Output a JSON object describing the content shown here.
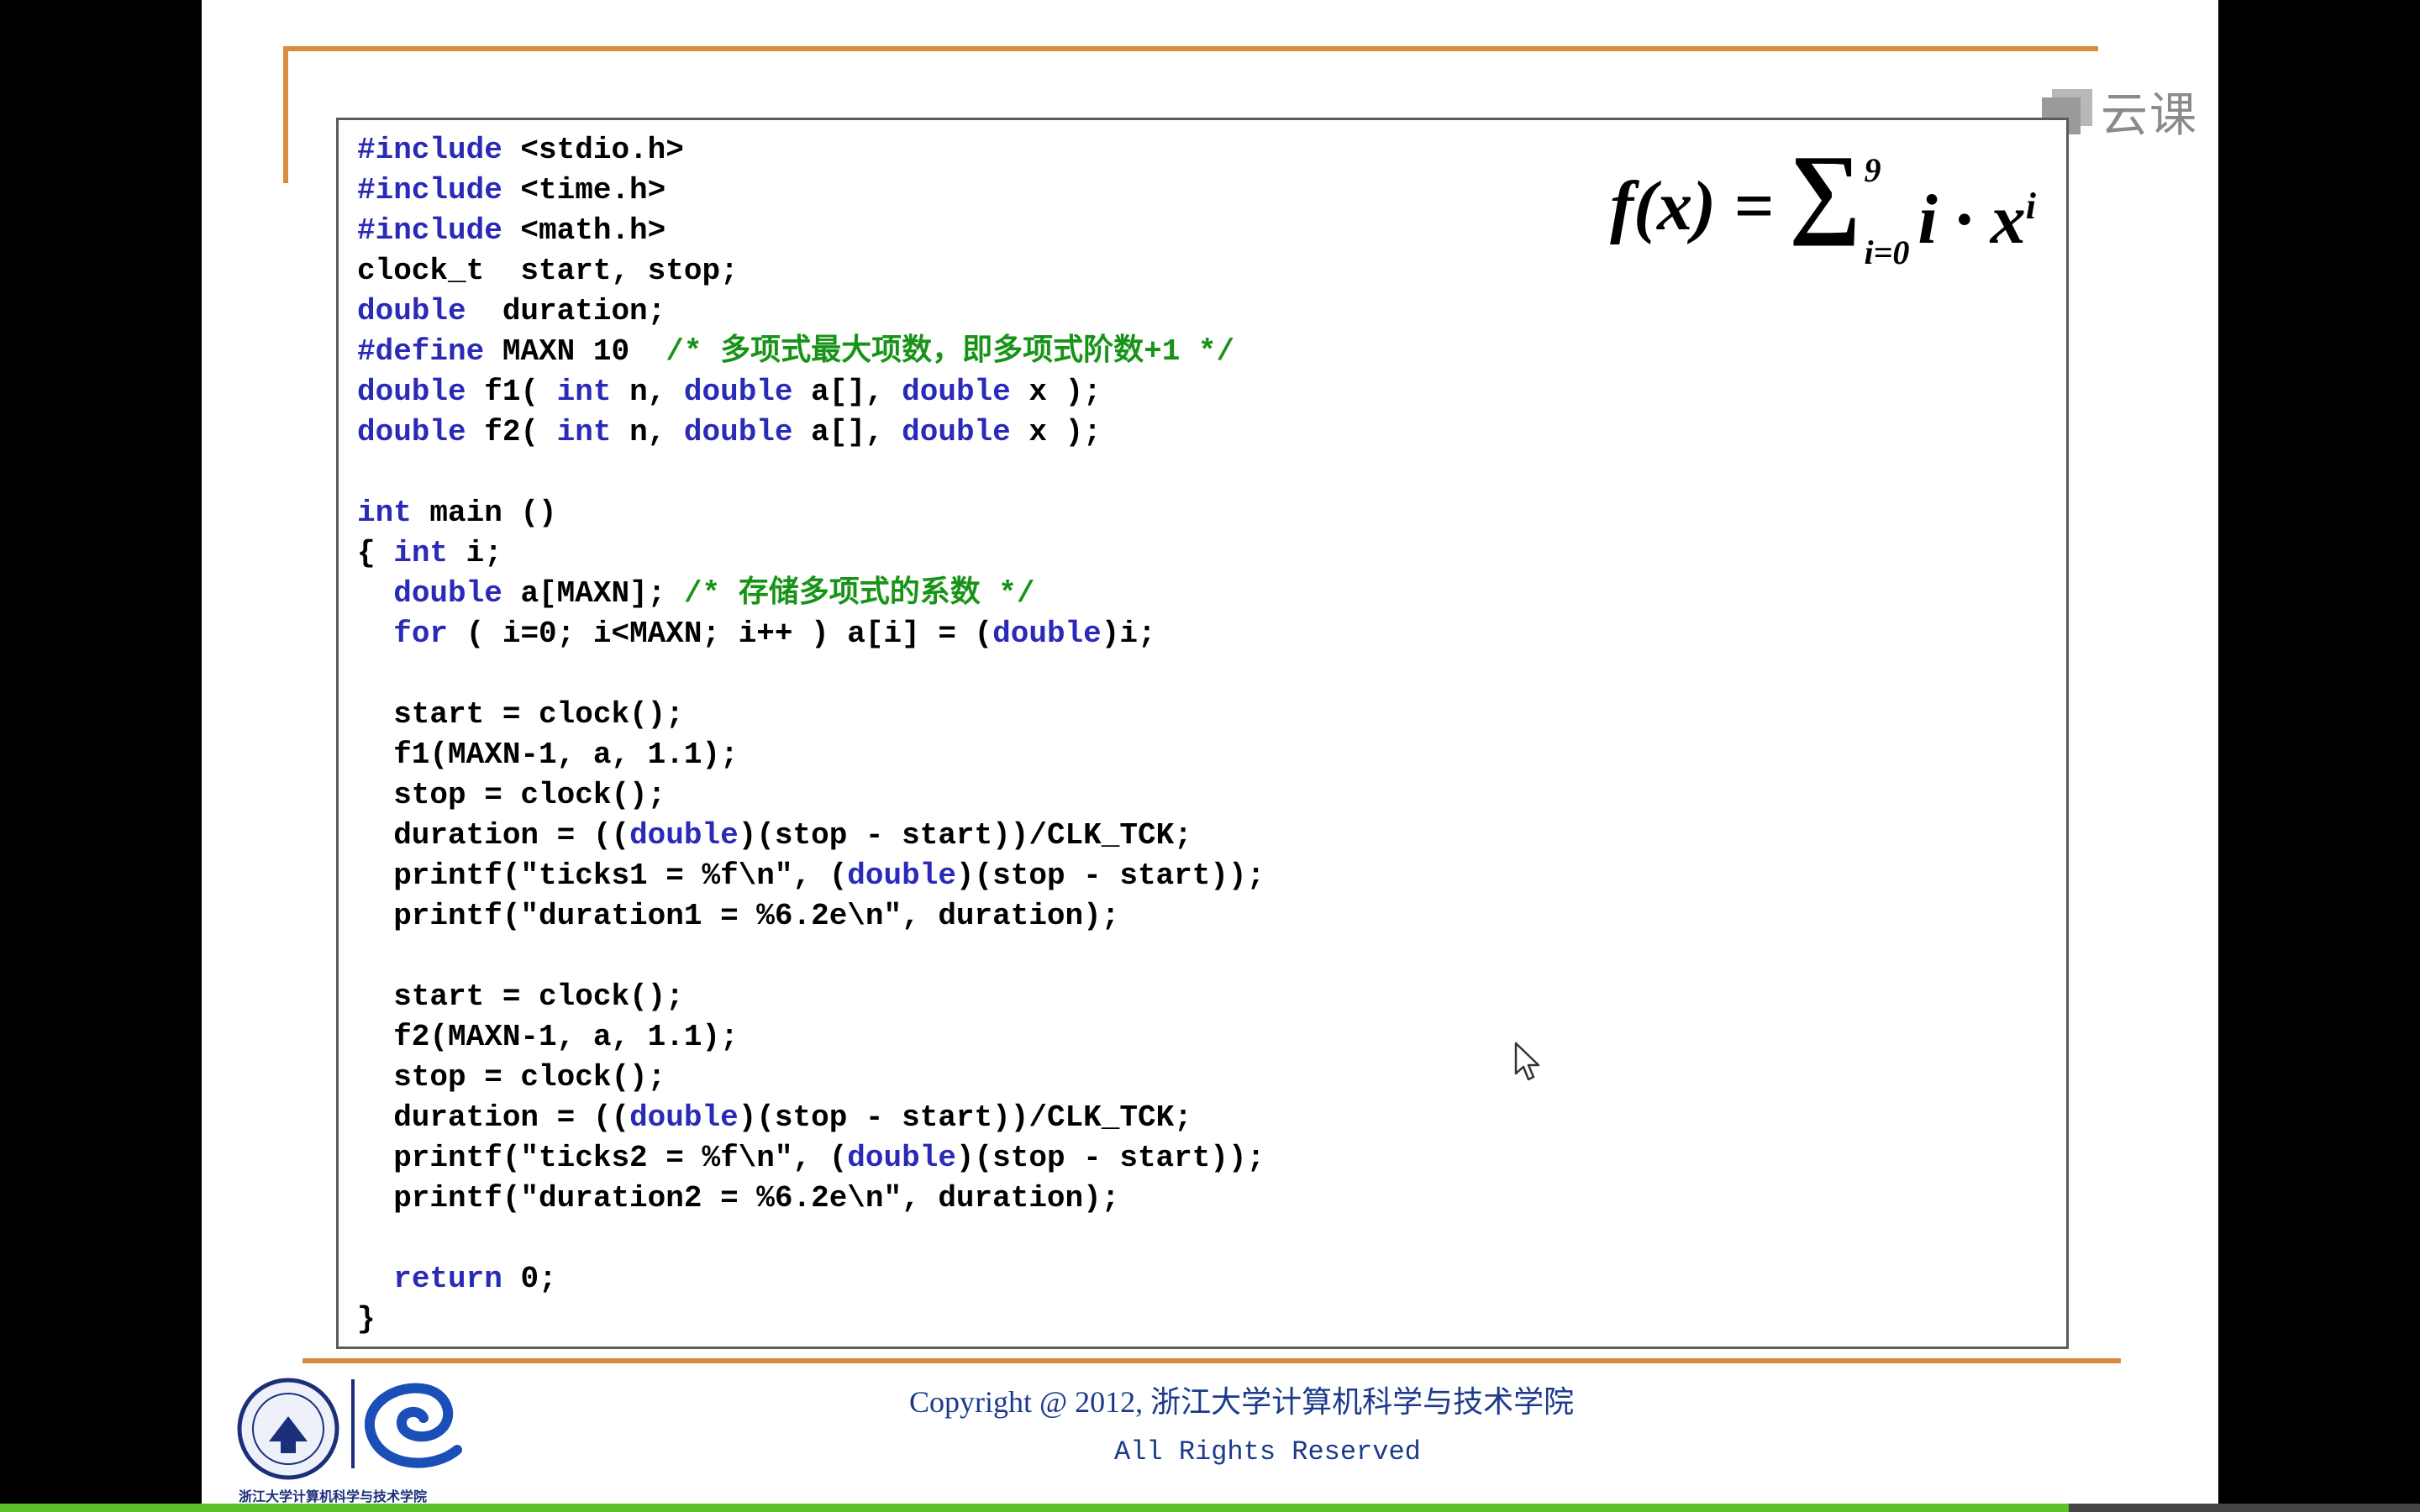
{
  "slide": {
    "formula": {
      "lhs": "f(x)",
      "equals": "=",
      "sum_symbol": "∑",
      "upper_limit": "9",
      "lower_limit": "i=0",
      "term": "i · x",
      "exponent": "i"
    },
    "watermark": {
      "text": "云课",
      "icon": "video-player-icon"
    },
    "code_lines": [
      [
        {
          "k": "kw",
          "t": "#include"
        },
        {
          "t": " <stdio.h>"
        }
      ],
      [
        {
          "k": "kw",
          "t": "#include"
        },
        {
          "t": " <time.h>"
        }
      ],
      [
        {
          "k": "kw",
          "t": "#include"
        },
        {
          "t": " <math.h>"
        }
      ],
      [
        {
          "t": "clock_t  start, stop;"
        }
      ],
      [
        {
          "k": "kw",
          "t": "double"
        },
        {
          "t": "  duration;"
        }
      ],
      [
        {
          "k": "kw",
          "t": "#define"
        },
        {
          "t": " MAXN 10  "
        },
        {
          "k": "cm",
          "t": "/* 多项式最大项数，即多项式阶数+1 */"
        }
      ],
      [
        {
          "k": "kw",
          "t": "double"
        },
        {
          "t": " f1( "
        },
        {
          "k": "kw",
          "t": "int"
        },
        {
          "t": " n, "
        },
        {
          "k": "kw",
          "t": "double"
        },
        {
          "t": " a[], "
        },
        {
          "k": "kw",
          "t": "double"
        },
        {
          "t": " x );"
        }
      ],
      [
        {
          "k": "kw",
          "t": "double"
        },
        {
          "t": " f2( "
        },
        {
          "k": "kw",
          "t": "int"
        },
        {
          "t": " n, "
        },
        {
          "k": "kw",
          "t": "double"
        },
        {
          "t": " a[], "
        },
        {
          "k": "kw",
          "t": "double"
        },
        {
          "t": " x );"
        }
      ],
      [
        {
          "t": ""
        }
      ],
      [
        {
          "k": "kw",
          "t": "int"
        },
        {
          "t": " main ()"
        }
      ],
      [
        {
          "t": "{ "
        },
        {
          "k": "kw",
          "t": "int"
        },
        {
          "t": " i;"
        }
      ],
      [
        {
          "t": "  "
        },
        {
          "k": "kw",
          "t": "double"
        },
        {
          "t": " a[MAXN]; "
        },
        {
          "k": "cm",
          "t": "/* 存储多项式的系数 */"
        }
      ],
      [
        {
          "t": "  "
        },
        {
          "k": "kw",
          "t": "for"
        },
        {
          "t": " ( i=0; i<MAXN; i++ ) a[i] = ("
        },
        {
          "k": "kw",
          "t": "double"
        },
        {
          "t": ")i;"
        }
      ],
      [
        {
          "t": ""
        }
      ],
      [
        {
          "t": "  start = clock();"
        }
      ],
      [
        {
          "t": "  f1(MAXN-1, a, 1.1);"
        }
      ],
      [
        {
          "t": "  stop = clock();"
        }
      ],
      [
        {
          "t": "  duration = (("
        },
        {
          "k": "kw",
          "t": "double"
        },
        {
          "t": ")(stop - start))/CLK_TCK;"
        }
      ],
      [
        {
          "t": "  printf(\"ticks1 = %f\\n\", ("
        },
        {
          "k": "kw",
          "t": "double"
        },
        {
          "t": ")(stop - start));"
        }
      ],
      [
        {
          "t": "  printf(\"duration1 = %6.2e\\n\", duration);"
        }
      ],
      [
        {
          "t": ""
        }
      ],
      [
        {
          "t": "  start = clock();"
        }
      ],
      [
        {
          "t": "  f2(MAXN-1, a, 1.1);"
        }
      ],
      [
        {
          "t": "  stop = clock();"
        }
      ],
      [
        {
          "t": "  duration = (("
        },
        {
          "k": "kw",
          "t": "double"
        },
        {
          "t": ")(stop - start))/CLK_TCK;"
        }
      ],
      [
        {
          "t": "  printf(\"ticks2 = %f\\n\", ("
        },
        {
          "k": "kw",
          "t": "double"
        },
        {
          "t": ")(stop - start));"
        }
      ],
      [
        {
          "t": "  printf(\"duration2 = %6.2e\\n\", duration);"
        }
      ],
      [
        {
          "t": ""
        }
      ],
      [
        {
          "t": "  "
        },
        {
          "k": "kw",
          "t": "return"
        },
        {
          "t": " 0;"
        }
      ],
      [
        {
          "t": "}"
        }
      ]
    ],
    "footer": {
      "copyright": "Copyright @ 2012, 浙江大学计算机科学与技术学院",
      "rights": "All Rights Reserved",
      "logo_caption": "浙江大学计算机科学与技术学院"
    }
  },
  "player": {
    "progress_fraction": 0.855
  },
  "colors": {
    "keyword": "#2a2ab8",
    "comment": "#179317",
    "accent": "#d98b3e",
    "footer_text": "#1b3a8c",
    "progress": "#5cc12a"
  }
}
